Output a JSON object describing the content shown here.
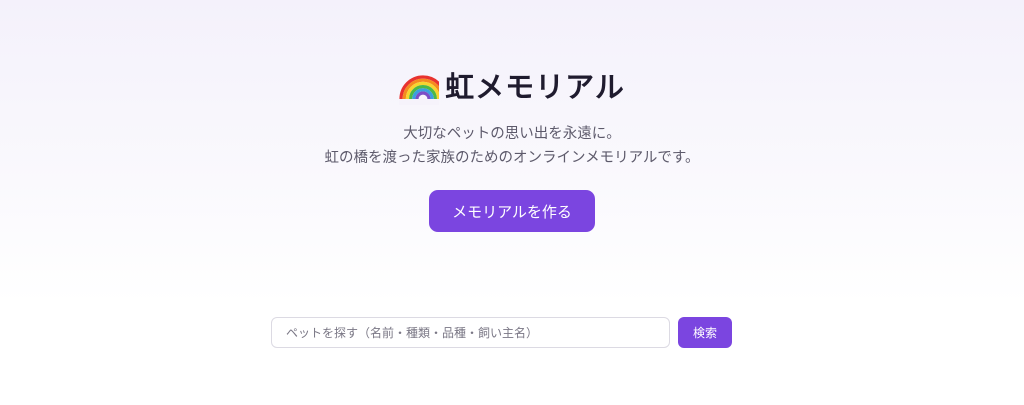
{
  "hero": {
    "icon": "rainbow-icon",
    "title": "虹メモリアル",
    "tagline_line1": "大切なペットの思い出を永遠に。",
    "tagline_line2": "虹の橋を渡った家族のためのオンラインメモリアルです。",
    "cta_label": "メモリアルを作る"
  },
  "search": {
    "placeholder": "ペットを探す（名前・種類・品種・飼い主名）",
    "value": "",
    "button_label": "検索"
  },
  "colors": {
    "accent": "#7b45e0",
    "title_text": "#1f1b2e",
    "body_text": "#5d5a6b"
  }
}
